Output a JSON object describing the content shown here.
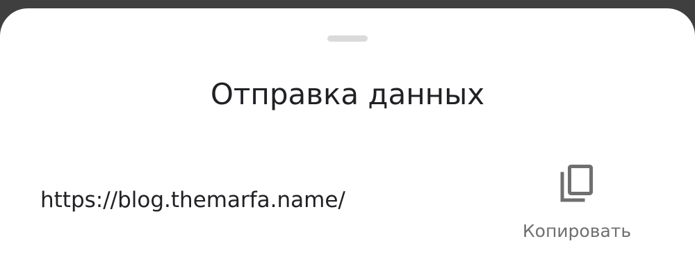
{
  "sheet": {
    "title": "Отправка данных",
    "url": "https://blog.themarfa.name/",
    "copy_label": "Копировать"
  },
  "icons": {
    "copy": "copy-icon"
  },
  "colors": {
    "title": "#202124",
    "secondary_text": "#6f6f6f",
    "icon": "#6f6f6f",
    "handle": "#dadada",
    "backdrop": "#3f3f3f",
    "sheet": "#ffffff"
  }
}
